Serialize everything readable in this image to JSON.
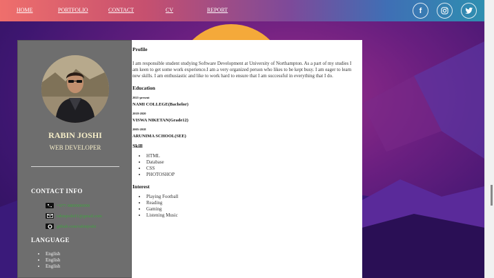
{
  "nav": {
    "links": [
      "HOME",
      "PORTFOLIO",
      "CONTACT",
      "CV",
      "REPORT"
    ],
    "social_icons": [
      "facebook-icon",
      "instagram-icon",
      "twitter-icon"
    ]
  },
  "sidebar": {
    "name": "RABIN JOSHI",
    "role": "WEB DEVELOPER",
    "contact_heading": "CONTACT INFO",
    "contacts": [
      {
        "icon": "phone-icon",
        "text": "+977-9800000000"
      },
      {
        "icon": "email-icon",
        "text": "rabinjoshi11@gmail.com"
      },
      {
        "icon": "github-icon",
        "text": "github.com/rabinjoshi"
      }
    ],
    "language_heading": "LANGUAGE",
    "languages": [
      "English",
      "English",
      "English"
    ]
  },
  "main": {
    "profile_heading": "Profile",
    "profile_text": "I am responsible student studying Software Development at University of Northampton. As a part of my studies I am keen to get some work experience.I am a very organized person who likes to be kept busy. I am eager to learn new skills. I am enthusiastic and like to work hard to ensure that I am successful in everything that I do.",
    "education_heading": "Education",
    "education": [
      {
        "years": "2021-present",
        "school": "NAMI COLLEGE(Bachelor)"
      },
      {
        "years": "2018-2020",
        "school": "VISWA NIKETAN(Grade12)"
      },
      {
        "years": "2005-2018",
        "school": "ARUNIMA SCHOOL(SEE)"
      }
    ],
    "skill_heading": "Skill",
    "skills": [
      "HTML",
      "Database",
      "CSS",
      "PHOTOSHOP"
    ],
    "interest_heading": "Interest",
    "interests": [
      "Playing Football",
      "Reading",
      "Gaming",
      "Listening Music"
    ]
  },
  "colors": {
    "sidebar_bg": "#6e6e6e",
    "name_color": "#f7efc9",
    "contact_link": "#3fa33f"
  }
}
